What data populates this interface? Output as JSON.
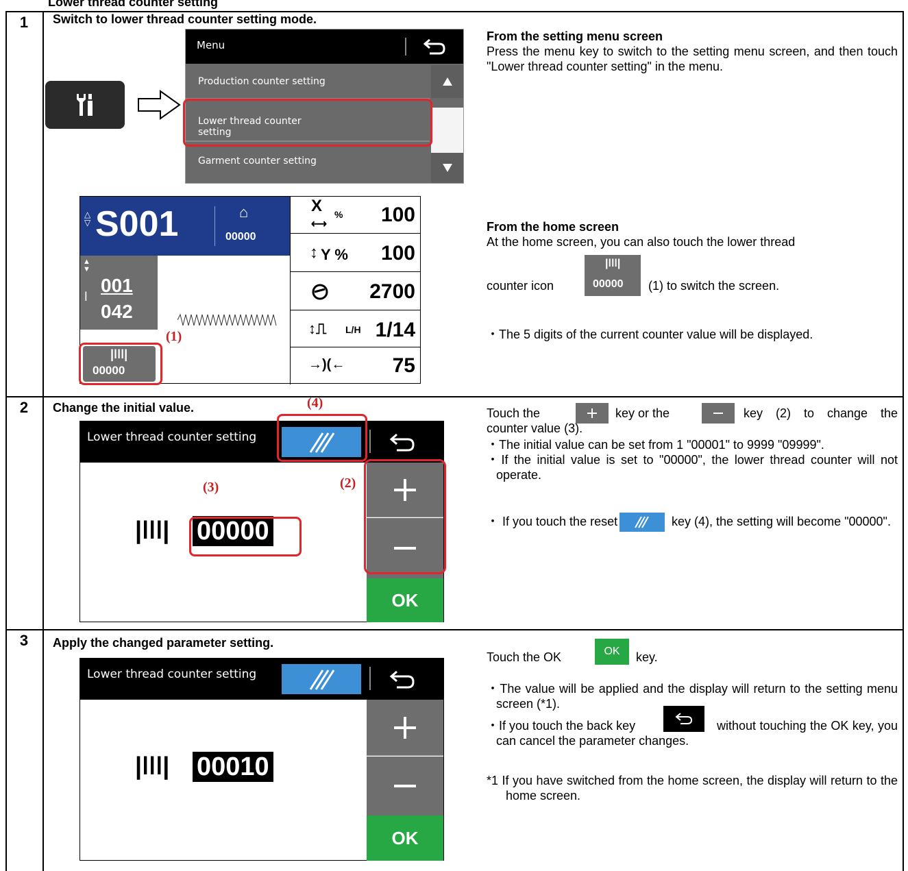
{
  "section_title": "Lower thread counter setting",
  "steps": [
    {
      "num": "1",
      "title": "Switch to lower thread counter setting mode.",
      "menu_screen": {
        "title": "Menu",
        "items": [
          "Production counter setting",
          "Lower thread counter setting",
          "Garment counter setting"
        ]
      },
      "home_screen": {
        "pattern": "S001",
        "garment_count": "00000",
        "stitch_current": "001",
        "stitch_total": "042",
        "lower_count": "00000",
        "x_label": "%",
        "x_value": "100",
        "y_label": "Y %",
        "y_value": "100",
        "speed_value": "2700",
        "lh_label": "L/H",
        "lh_value": "1/14",
        "tension_value": "75"
      },
      "desc_head1": "From the setting menu screen",
      "desc_text1": "Press the menu key to switch to the setting menu screen, and then touch \"Lower thread counter setting\" in the menu.",
      "desc_head2": "From the home screen",
      "desc_text2a": "At the home screen, you can also touch the lower thread",
      "desc_text2b": "counter icon",
      "desc_icon_value": "00000",
      "desc_text2c": "(1) to switch the screen.",
      "desc_note": "・The 5 digits of the current counter value will be displayed.",
      "callout_1": "(1)"
    },
    {
      "num": "2",
      "title": "Change the initial value.",
      "screen_title": "Lower thread counter setting",
      "value": "00000",
      "ok": "OK",
      "callout_2": "(2)",
      "callout_3": "(3)",
      "callout_4": "(4)",
      "desc_a": "Touch the",
      "desc_b": "key or the",
      "desc_c": "key (2) to change the counter value (3).",
      "note1": "・The initial value can be set from 1 \"00001\" to 9999 \"09999\".",
      "note2": "・If the initial value is set to \"00000\", the lower thread counter will not operate.",
      "note3a": "・ If you touch the reset",
      "note3b": "key (4), the setting will become \"00000\"."
    },
    {
      "num": "3",
      "title": "Apply the changed parameter setting.",
      "screen_title": "Lower thread counter setting",
      "value": "00010",
      "ok": "OK",
      "desc_a": "Touch the OK",
      "desc_key": "OK",
      "desc_b": "key.",
      "note1": "・The value will be applied and the display will return to the setting menu screen (*1).",
      "note2a": "・If you touch the back key",
      "note2b": "without touching the OK key, you can cancel the parameter changes.",
      "footnote": "*1 If you have switched from the home screen, the display will return to the home screen."
    }
  ],
  "colors": {
    "accent_blue": "#3d8fd6",
    "ok_green": "#27a844",
    "red": "#e0262b",
    "panel_gray": "#6e6e6e",
    "home_blue": "#1f3c8c"
  }
}
